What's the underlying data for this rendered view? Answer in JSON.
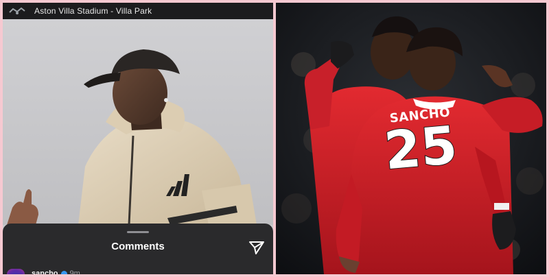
{
  "story": {
    "location": "Aston Villa Stadium - Villa Park",
    "comments_title": "Comments",
    "comment": {
      "username": "sancho",
      "time": "9m"
    }
  },
  "jersey": {
    "name": "SANCHO",
    "number": "25"
  },
  "colors": {
    "frame": "#f6c9d1",
    "sheet": "#2a2a2c",
    "united_red": "#d0202a",
    "verified_blue": "#3897f0"
  },
  "icons": [
    "location-logo-icon",
    "send-icon",
    "verified-icon",
    "adidas-logo-icon"
  ]
}
